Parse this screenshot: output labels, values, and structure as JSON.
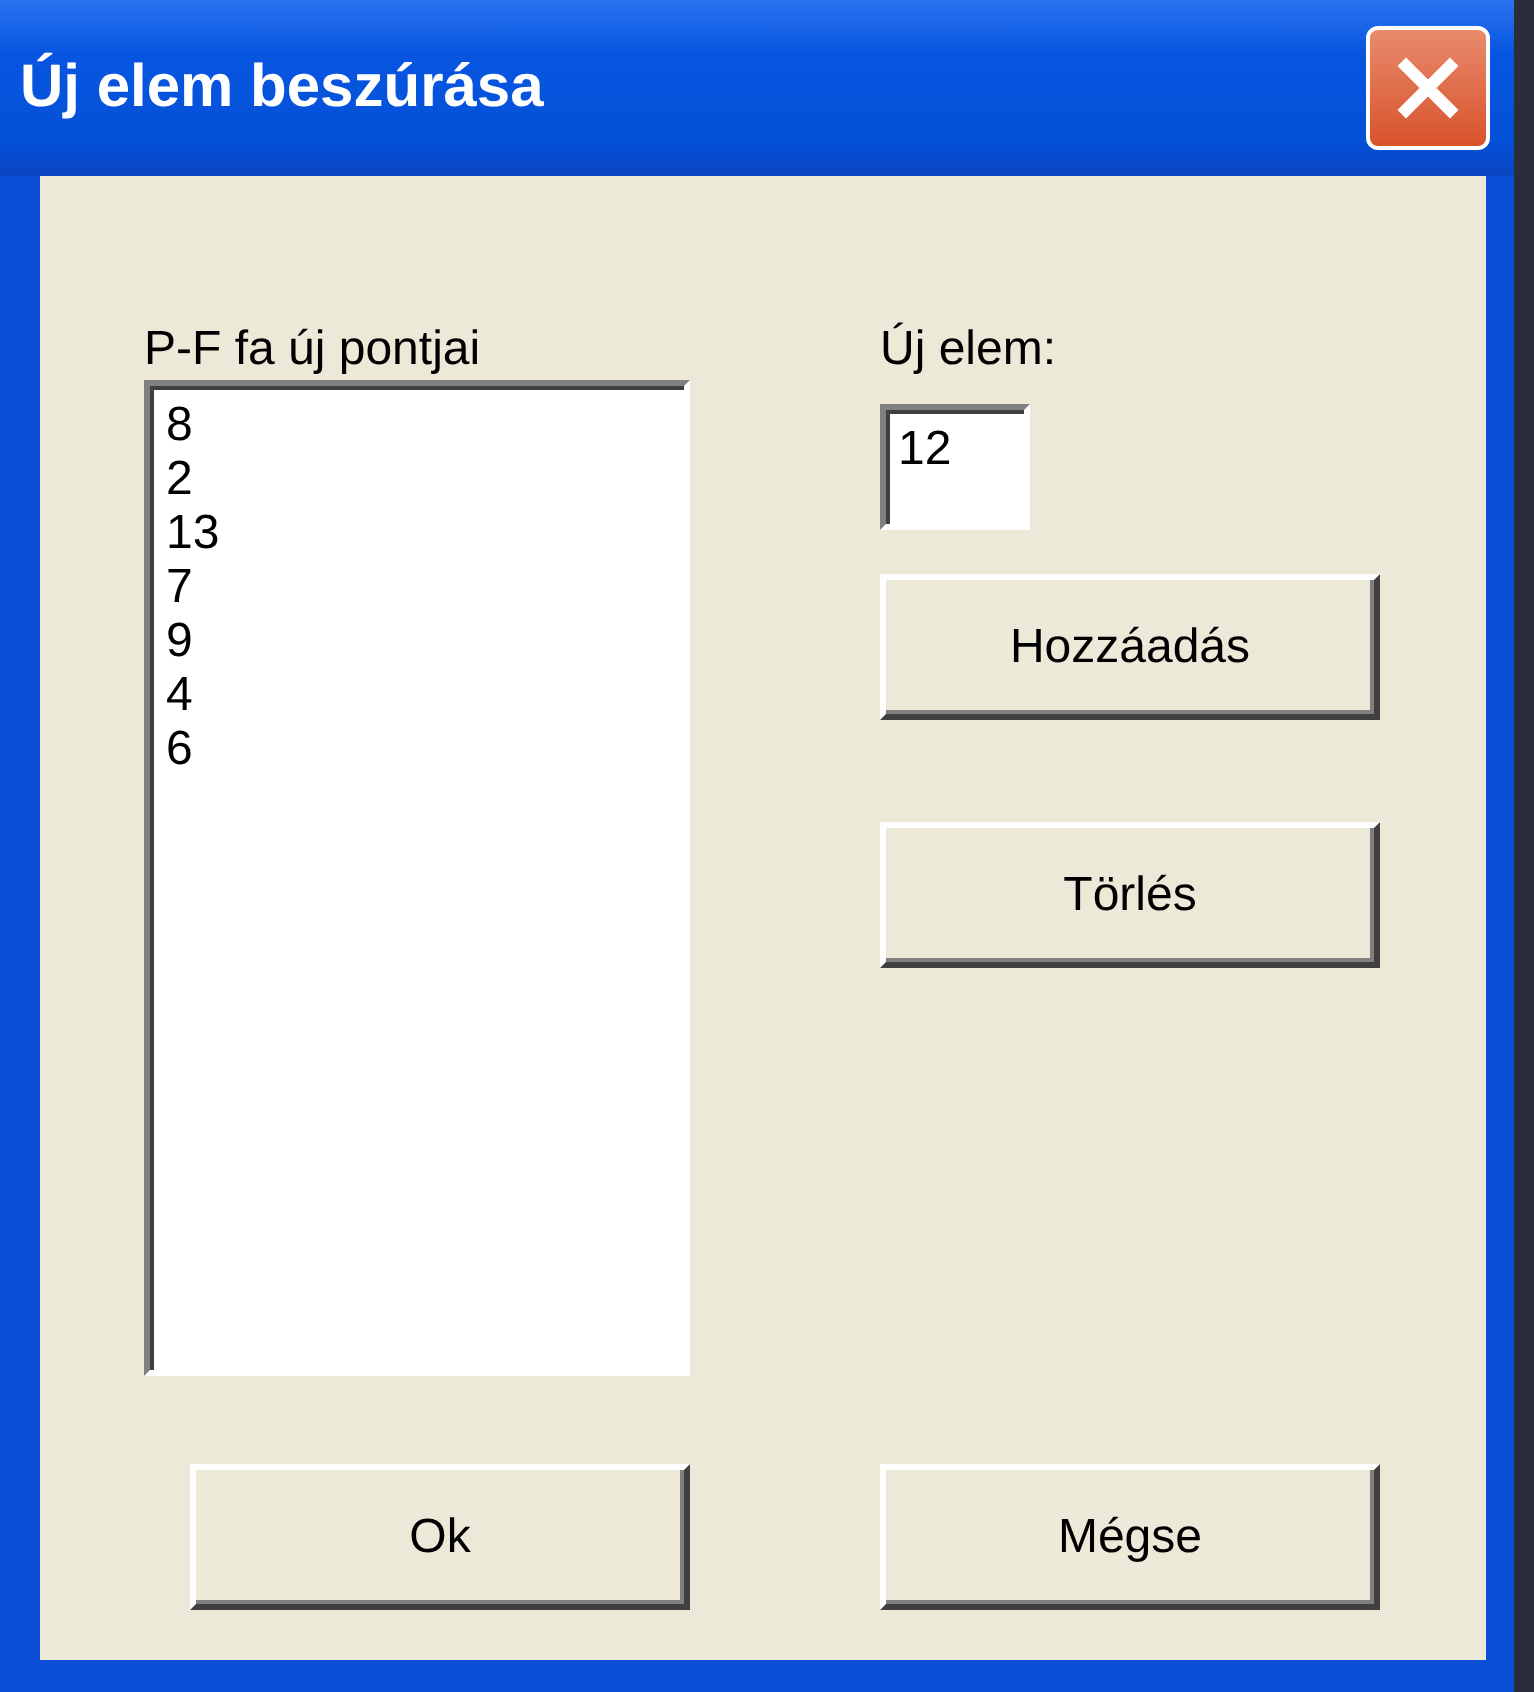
{
  "window": {
    "title": "Új elem beszúrása"
  },
  "list": {
    "label": "P-F fa új pontjai",
    "items": [
      "8",
      "2",
      "13",
      "7",
      "9",
      "4",
      "6"
    ]
  },
  "new_item": {
    "label": "Új elem:",
    "value": "12"
  },
  "side_buttons": [
    "Hozzáadás",
    "Törlés"
  ],
  "bottom_buttons": [
    "Ok",
    "Mégse"
  ]
}
